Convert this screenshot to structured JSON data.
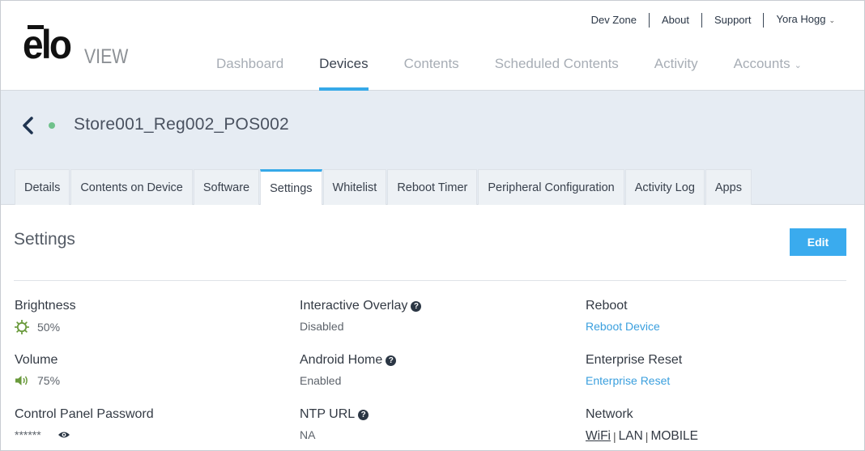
{
  "brand": {
    "logo_word": "elo",
    "logo_suffix": "VIEW"
  },
  "util_nav": {
    "dev_zone": "Dev Zone",
    "about": "About",
    "support": "Support",
    "user": "Yora Hogg"
  },
  "main_nav": {
    "items": [
      {
        "label": "Dashboard",
        "active": false
      },
      {
        "label": "Devices",
        "active": true
      },
      {
        "label": "Contents",
        "active": false
      },
      {
        "label": "Scheduled Contents",
        "active": false
      },
      {
        "label": "Activity",
        "active": false
      },
      {
        "label": "Accounts",
        "active": false,
        "dropdown": true
      }
    ]
  },
  "device": {
    "name": "Store001_Reg002_POS002",
    "status": "online"
  },
  "tabs": [
    {
      "label": "Details",
      "active": false
    },
    {
      "label": "Contents on Device",
      "active": false
    },
    {
      "label": "Software",
      "active": false
    },
    {
      "label": "Settings",
      "active": true
    },
    {
      "label": "Whitelist",
      "active": false
    },
    {
      "label": "Reboot Timer",
      "active": false
    },
    {
      "label": "Peripheral Configuration",
      "active": false
    },
    {
      "label": "Activity Log",
      "active": false
    },
    {
      "label": "Apps",
      "active": false
    }
  ],
  "settings": {
    "title": "Settings",
    "edit_label": "Edit",
    "brightness": {
      "label": "Brightness",
      "value": "50%"
    },
    "volume": {
      "label": "Volume",
      "value": "75%"
    },
    "control_panel_password": {
      "label": "Control Panel Password",
      "value": "******"
    },
    "interactive_overlay": {
      "label": "Interactive Overlay",
      "value": "Disabled"
    },
    "android_home": {
      "label": "Android Home",
      "value": "Enabled"
    },
    "ntp_url": {
      "label": "NTP URL",
      "value": "NA"
    },
    "reboot": {
      "label": "Reboot",
      "link": "Reboot Device"
    },
    "enterprise_reset": {
      "label": "Enterprise Reset",
      "link": "Enterprise Reset"
    },
    "network": {
      "label": "Network",
      "options": [
        "WiFi",
        "LAN",
        "MOBILE"
      ],
      "separator": "|"
    }
  },
  "colors": {
    "accent": "#36a9e8",
    "link": "#3a9fde",
    "status_online": "#6fc18b",
    "icon_green": "#6a9a3c"
  }
}
